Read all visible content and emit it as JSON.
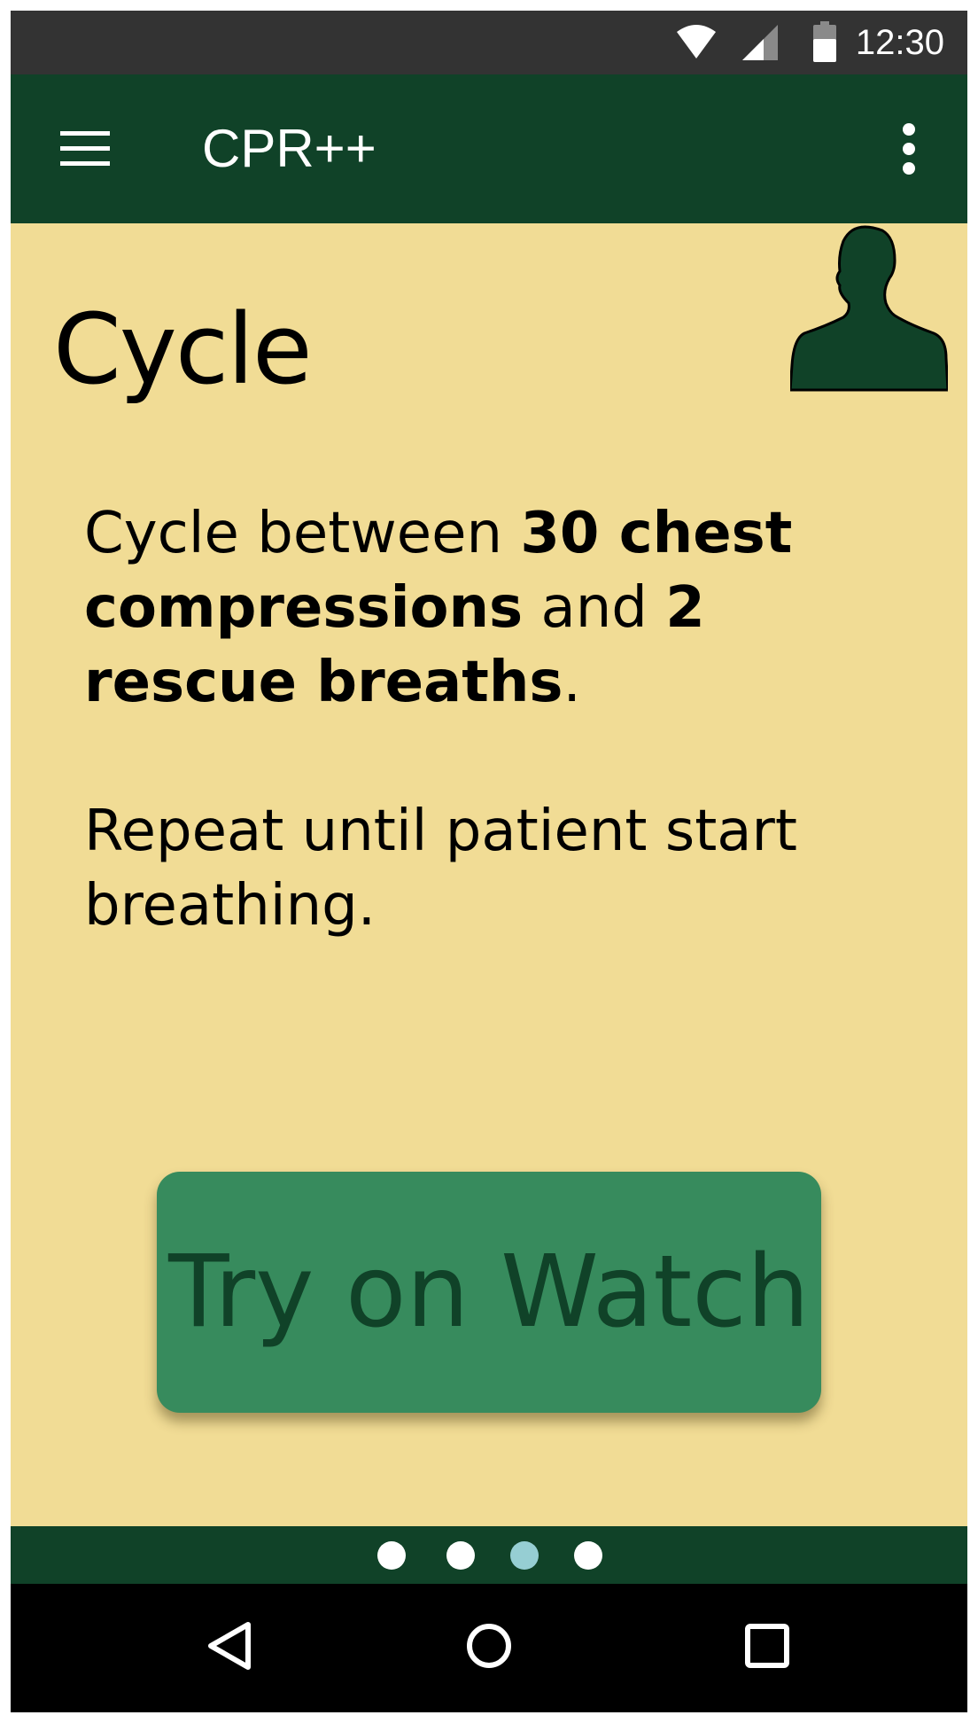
{
  "status_bar": {
    "time": "12:30",
    "icons": [
      "wifi-icon",
      "cell-signal-icon",
      "battery-icon"
    ]
  },
  "app_bar": {
    "menu_icon": "hamburger-menu-icon",
    "title": "CPR++",
    "overflow_icon": "more-vert-icon"
  },
  "page": {
    "heading": "Cycle",
    "avatar_icon": "person-silhouette-icon",
    "instruction": {
      "part1": "Cycle between ",
      "bold1": "30 chest compressions",
      "part2": " and ",
      "bold2": "2 rescue breaths",
      "part3": "."
    },
    "repeat_text": "Repeat until patient start breathing.",
    "watch_button_label": "Try on Watch"
  },
  "pager": {
    "count": 4,
    "active_index": 2
  },
  "nav_bar": {
    "icons": [
      "back-icon",
      "home-icon",
      "recents-icon"
    ]
  },
  "colors": {
    "background": "#f1dc95",
    "app_bar": "#104228",
    "status_bar": "#333333",
    "button": "#378b5d",
    "button_text": "#104228",
    "active_dot": "#96ced3"
  }
}
